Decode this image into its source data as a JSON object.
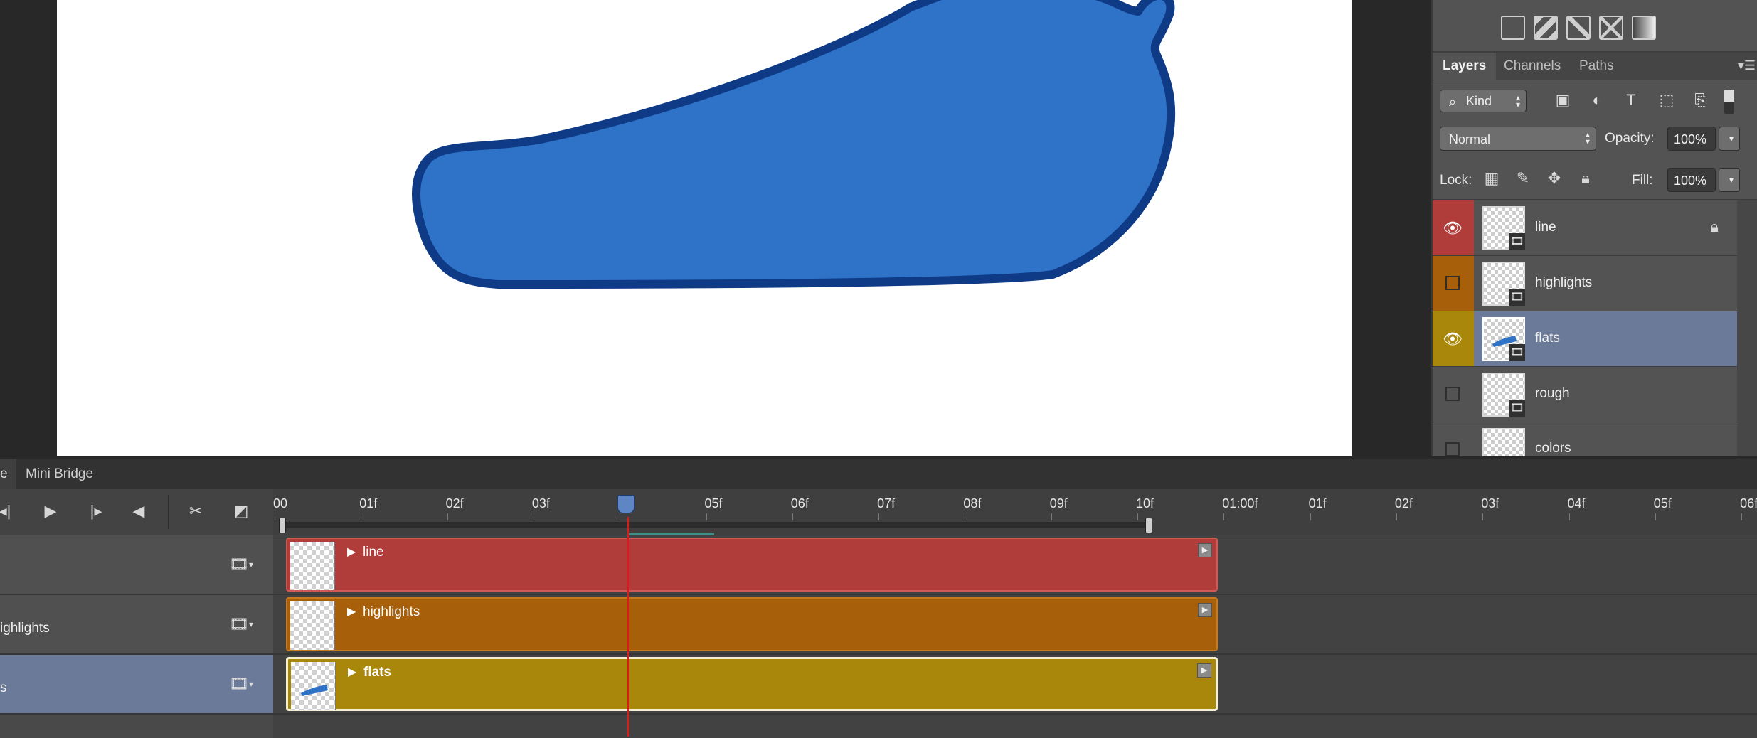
{
  "layers_panel": {
    "tabs": [
      "Layers",
      "Channels",
      "Paths"
    ],
    "panel_menu_icon": "panel-menu-icon",
    "adjustment_icons": [
      "vibrance-icon",
      "hue-saturation-icon",
      "levels-icon",
      "channel-mixer-icon",
      "gradient-map-icon"
    ],
    "filter": {
      "kind_label": "Kind",
      "icons": [
        "pixel-layer-filter-icon",
        "adjustment-layer-filter-icon",
        "type-layer-filter-icon",
        "shape-layer-filter-icon",
        "smart-object-filter-icon"
      ]
    },
    "blend_mode": "Normal",
    "opacity_label": "Opacity:",
    "opacity_value": "100%",
    "lock_label": "Lock:",
    "fill_label": "Fill:",
    "fill_value": "100%",
    "layers": [
      {
        "name": "line",
        "color": "#b13d3a",
        "visible": true,
        "locked": true,
        "selected": false
      },
      {
        "name": "highlights",
        "color": "#a75f0a",
        "visible": false,
        "locked": false,
        "selected": false
      },
      {
        "name": "flats",
        "color": "#a9870a",
        "visible": true,
        "locked": false,
        "selected": true
      },
      {
        "name": "rough",
        "color": "#535353",
        "visible": false,
        "locked": false,
        "selected": false
      },
      {
        "name": "colors",
        "color": "#535353",
        "visible": false,
        "locked": false,
        "selected": false
      }
    ]
  },
  "timeline": {
    "tabs": [
      "e",
      "Mini Bridge"
    ],
    "ruler_labels": [
      "00",
      "01f",
      "02f",
      "03f",
      "04f",
      "05f",
      "06f",
      "07f",
      "08f",
      "09f",
      "10f",
      "01:00f",
      "01f",
      "02f",
      "03f",
      "04f",
      "05f",
      "06f"
    ],
    "track_headers": [
      "",
      "ighlights",
      "s"
    ],
    "clips": [
      {
        "name": "line",
        "color": "#b13d3a",
        "border": "#cf5a55",
        "selected": false
      },
      {
        "name": "highlights",
        "color": "#a75f0a",
        "border": "#c77a20",
        "selected": false
      },
      {
        "name": "flats",
        "color": "#a9870a",
        "border": "#f4f0d0",
        "selected": true
      }
    ],
    "playhead_frame": 4
  },
  "canvas": {
    "fill_color": "#2f73c8",
    "stroke_color": "#0e3a86"
  }
}
